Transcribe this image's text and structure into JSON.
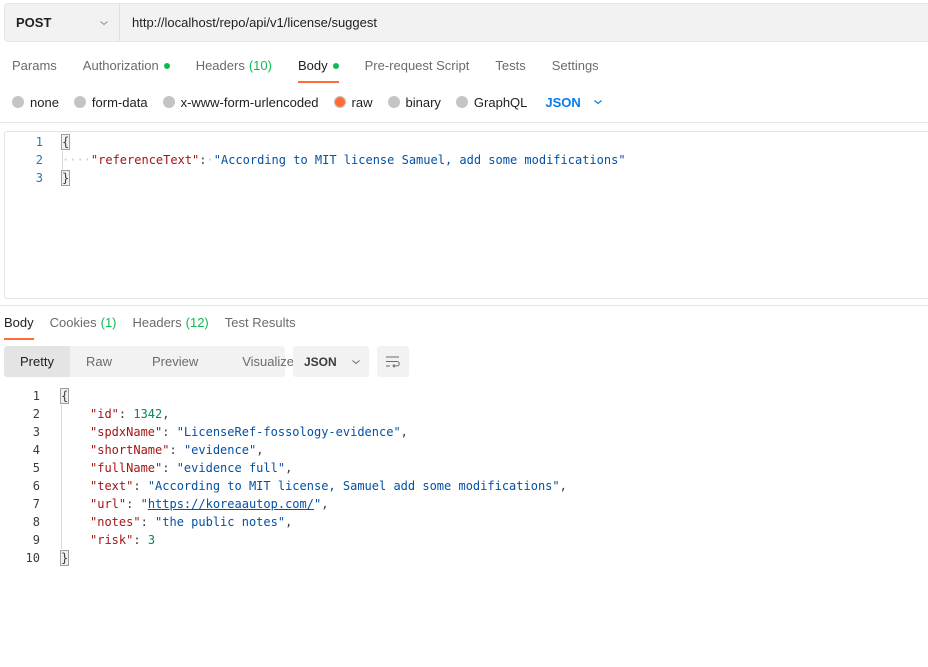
{
  "request": {
    "method": "POST",
    "url": "http://localhost/repo/api/v1/license/suggest"
  },
  "request_tabs": [
    {
      "label": "Params"
    },
    {
      "label": "Authorization",
      "indicator": "dot"
    },
    {
      "label": "Headers",
      "count": "(10)"
    },
    {
      "label": "Body",
      "indicator": "dot",
      "active": true
    },
    {
      "label": "Pre-request Script"
    },
    {
      "label": "Tests"
    },
    {
      "label": "Settings"
    }
  ],
  "body_types": [
    {
      "label": "none"
    },
    {
      "label": "form-data"
    },
    {
      "label": "x-www-form-urlencoded"
    },
    {
      "label": "raw",
      "selected": true
    },
    {
      "label": "binary"
    },
    {
      "label": "GraphQL"
    }
  ],
  "raw_language": "JSON",
  "request_body": {
    "line_numbers": [
      "1",
      "2",
      "3"
    ],
    "open_brace": "{",
    "close_brace": "}",
    "key": "\"referenceText\"",
    "colon": ":",
    "value": "\"According to MIT license Samuel, add some modifications\""
  },
  "response_tabs": [
    {
      "label": "Body",
      "active": true
    },
    {
      "label": "Cookies",
      "count": "(1)"
    },
    {
      "label": "Headers",
      "count": "(12)"
    },
    {
      "label": "Test Results"
    }
  ],
  "response_views": [
    "Pretty",
    "Raw",
    "Preview",
    "Visualize"
  ],
  "response_format": "JSON",
  "response_body": {
    "line_numbers": [
      "1",
      "2",
      "3",
      "4",
      "5",
      "6",
      "7",
      "8",
      "9",
      "10"
    ],
    "open_brace": "{",
    "close_brace": "}",
    "fields": [
      {
        "key": "\"id\"",
        "value": "1342",
        "type": "number",
        "comma": ","
      },
      {
        "key": "\"spdxName\"",
        "value": "\"LicenseRef-fossology-evidence\"",
        "type": "string",
        "comma": ","
      },
      {
        "key": "\"shortName\"",
        "value": "\"evidence\"",
        "type": "string",
        "comma": ","
      },
      {
        "key": "\"fullName\"",
        "value": "\"evidence full\"",
        "type": "string",
        "comma": ","
      },
      {
        "key": "\"text\"",
        "value": "\"According to MIT license, Samuel add some modifications\"",
        "type": "string",
        "comma": ","
      },
      {
        "key": "\"url\"",
        "value": "https://koreaautop.com/",
        "type": "link",
        "comma": ","
      },
      {
        "key": "\"notes\"",
        "value": "\"the public notes\"",
        "type": "string",
        "comma": ","
      },
      {
        "key": "\"risk\"",
        "value": "3",
        "type": "number",
        "comma": ""
      }
    ]
  },
  "colors": {
    "accent": "#ff6c37",
    "status_green": "#0cbb52",
    "link_blue": "#097bed"
  }
}
